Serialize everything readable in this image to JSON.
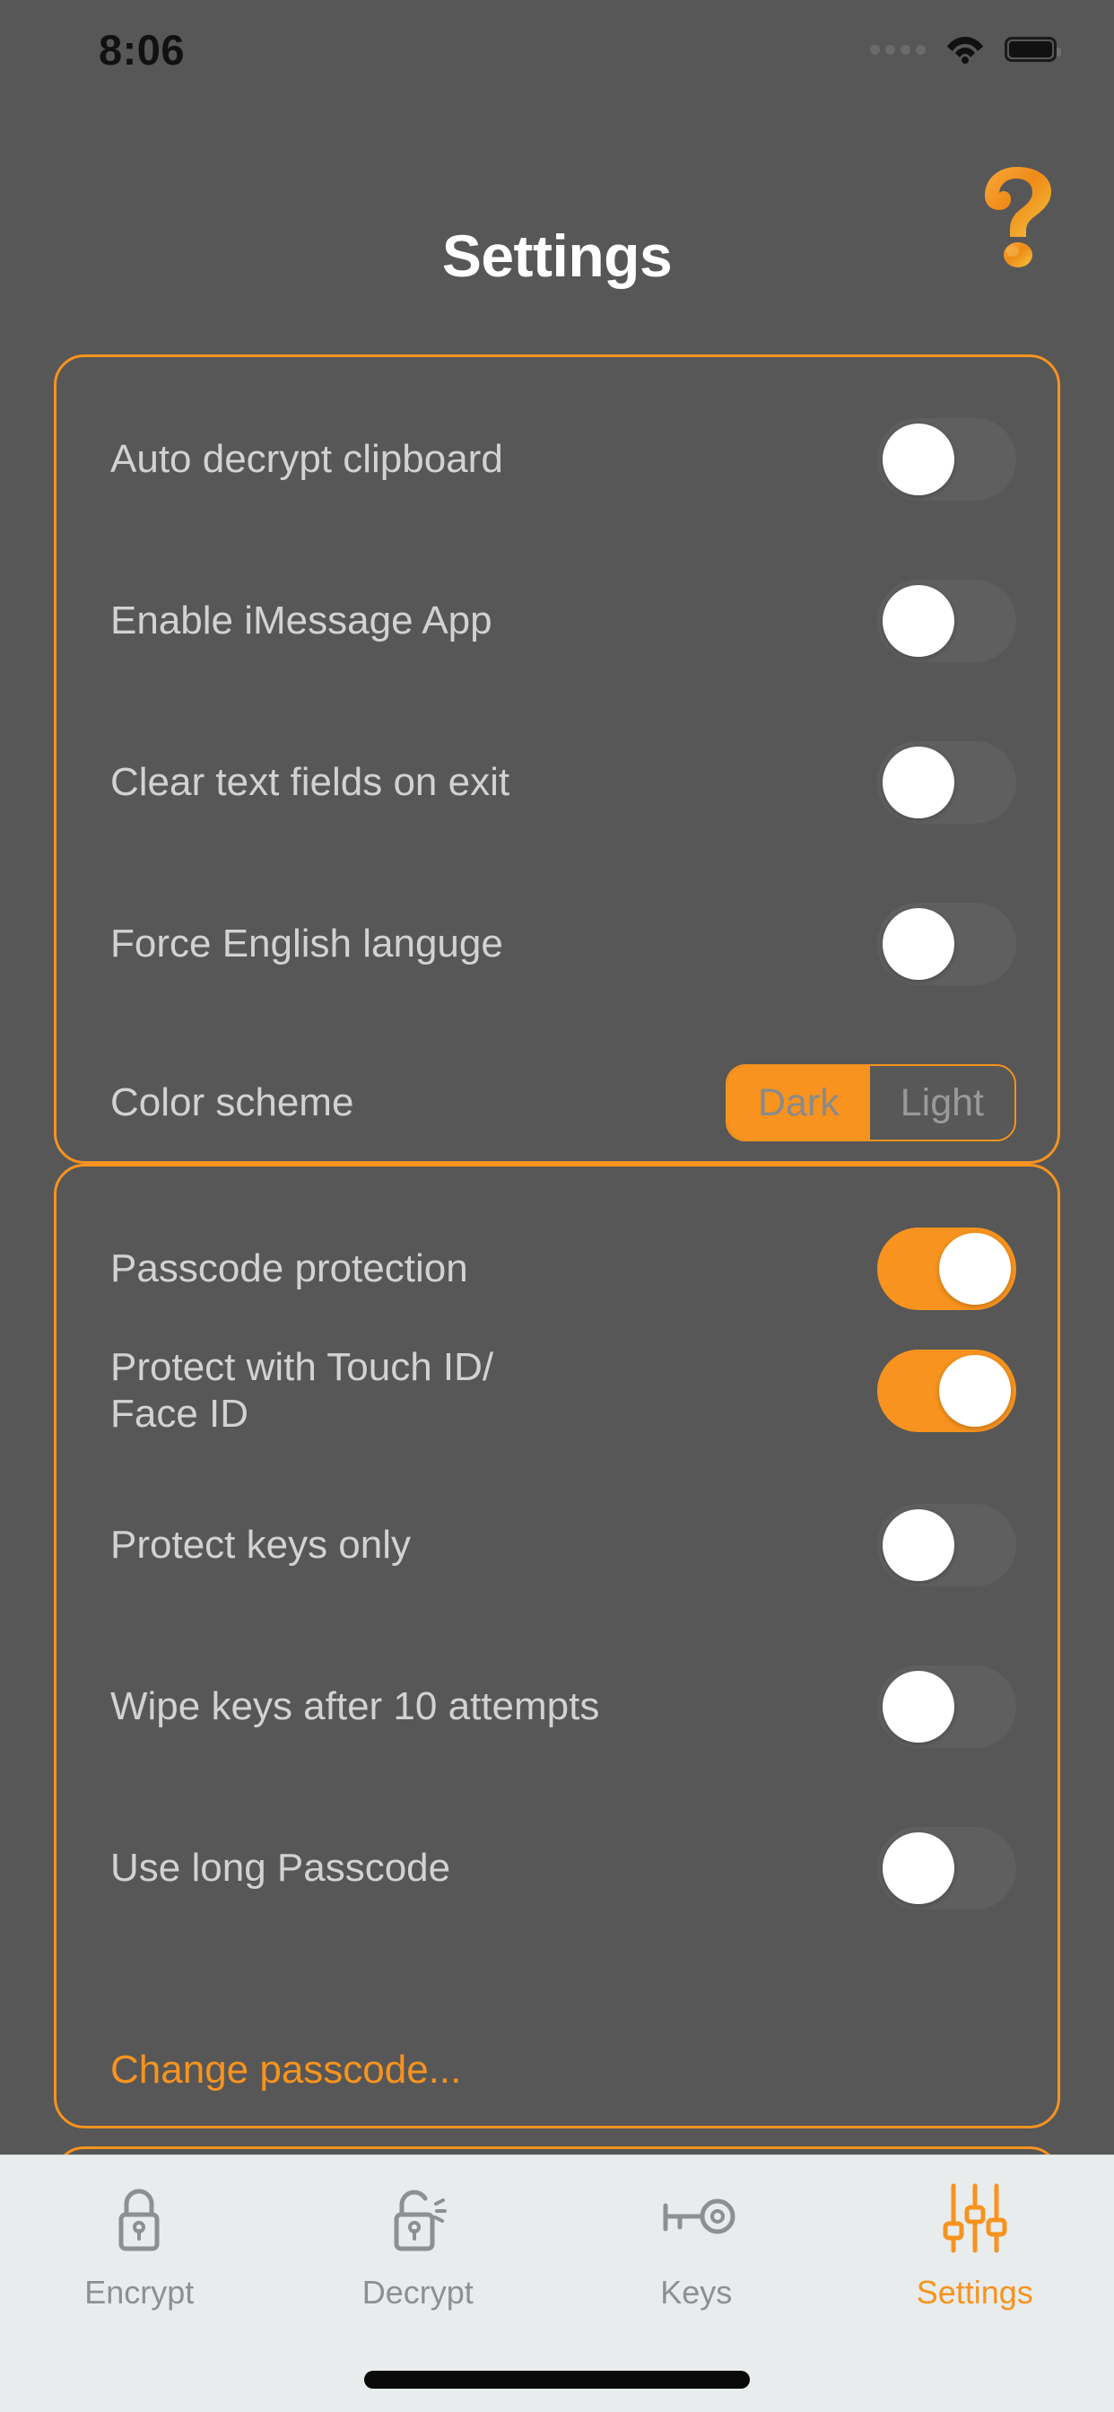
{
  "status_bar": {
    "time": "8:06",
    "icons": [
      "signal-dots-icon",
      "wifi-icon",
      "battery-icon"
    ]
  },
  "header": {
    "title": "Settings",
    "help_icon": "question-mark-icon"
  },
  "general_card": {
    "rows": [
      {
        "label": "Auto decrypt clipboard",
        "control": "toggle",
        "state": "off"
      },
      {
        "label": "Enable iMessage App",
        "control": "toggle",
        "state": "off"
      },
      {
        "label": "Clear text fields on exit",
        "control": "toggle",
        "state": "off"
      },
      {
        "label": "Force English languge",
        "control": "toggle",
        "state": "off"
      },
      {
        "label": "Color scheme",
        "control": "segmented"
      }
    ],
    "color_scheme": {
      "options": [
        "Dark",
        "Light"
      ],
      "selected": "Dark"
    }
  },
  "security_card": {
    "rows": [
      {
        "label": "Passcode protection",
        "control": "toggle",
        "state": "on"
      },
      {
        "label": "Protect with Touch ID/\nFace ID",
        "control": "toggle",
        "state": "on"
      },
      {
        "label": "Protect keys only",
        "control": "toggle",
        "state": "off"
      },
      {
        "label": "Wipe keys after 10 attempts",
        "control": "toggle",
        "state": "off"
      },
      {
        "label": "Use long Passcode",
        "control": "toggle",
        "state": "off"
      }
    ],
    "change_passcode_label": "Change passcode..."
  },
  "tab_bar": {
    "tabs": [
      {
        "label": "Encrypt",
        "icon": "lock-closed-icon",
        "active": false
      },
      {
        "label": "Decrypt",
        "icon": "lock-open-icon",
        "active": false
      },
      {
        "label": "Keys",
        "icon": "key-icon",
        "active": false
      },
      {
        "label": "Settings",
        "icon": "sliders-icon",
        "active": true
      }
    ]
  },
  "colors": {
    "accent": "#f7931e",
    "background": "#575757",
    "label_text": "#d2d2d2",
    "tabbar_background": "#e8ecec",
    "tab_inactive": "#8c9090"
  }
}
